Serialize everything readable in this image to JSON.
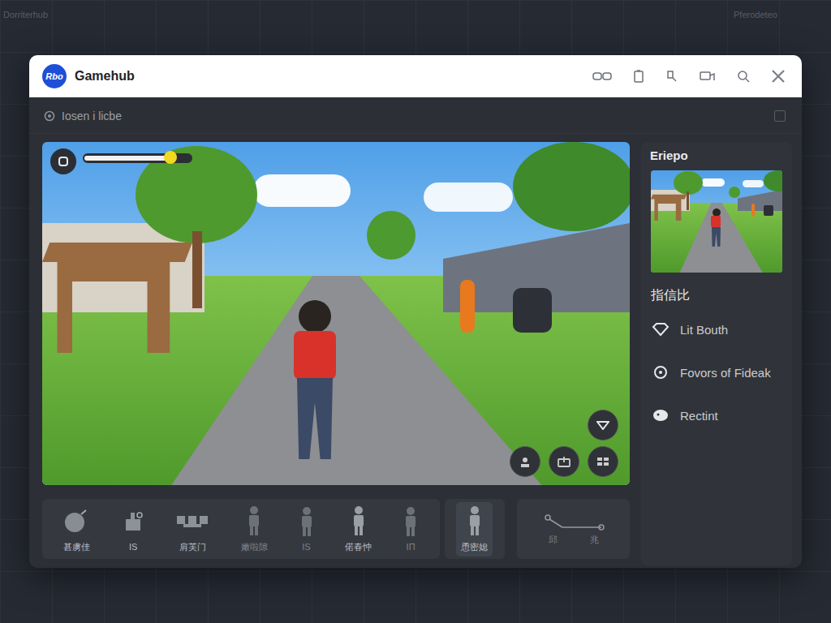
{
  "window": {
    "title": "Gamehub",
    "logo": "Rbo"
  },
  "subheader": {
    "title": "Iosen i licbe",
    "checked": false
  },
  "hud": {
    "level": 0.8
  },
  "sidebar": {
    "title": "Eriepo",
    "section": "指信比",
    "items": [
      {
        "label": "Lit Bouth",
        "kind": "diamond"
      },
      {
        "label": "Fovors of Fideak",
        "kind": "ring"
      },
      {
        "label": "Rectint",
        "kind": "blob"
      }
    ]
  },
  "toolbar": {
    "items": [
      {
        "label": "甚虜佳",
        "kind": "bomb",
        "selected": false,
        "dimmed": false
      },
      {
        "label": "IS",
        "kind": "hand",
        "selected": false,
        "dimmed": false
      },
      {
        "label": "肩芙门",
        "kind": "blocks",
        "selected": false,
        "dimmed": false
      },
      {
        "label": "嫩啦隙",
        "kind": "figure",
        "selected": false,
        "dimmed": true
      },
      {
        "label": "IS",
        "kind": "figure",
        "selected": false,
        "dimmed": true
      },
      {
        "label": "偌春忡",
        "kind": "figure",
        "selected": false,
        "dimmed": false
      },
      {
        "label": "IΠ",
        "kind": "figure",
        "selected": false,
        "dimmed": true
      },
      {
        "label": "恿密媳",
        "kind": "figure",
        "selected": true,
        "dimmed": false
      }
    ],
    "tools": [
      "邱",
      "兆"
    ]
  },
  "background": {
    "texts": [
      "Dorriterhub",
      "Pferodeteo"
    ]
  }
}
